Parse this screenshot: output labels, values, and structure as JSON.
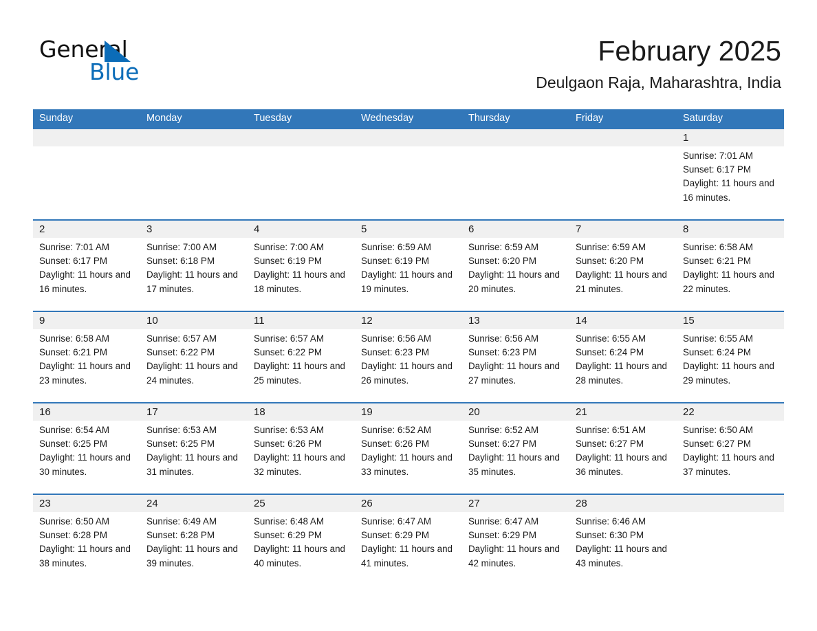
{
  "brand": {
    "name_part1": "General",
    "name_part2": "Blue",
    "accent_color": "#0b6cb8"
  },
  "header": {
    "title": "February 2025",
    "subtitle": "Deulgaon Raja, Maharashtra, India",
    "header_bar_color": "#3277b9",
    "daynum_band_color": "#f0f0f0"
  },
  "weekdays": [
    "Sunday",
    "Monday",
    "Tuesday",
    "Wednesday",
    "Thursday",
    "Friday",
    "Saturday"
  ],
  "weeks": [
    [
      {
        "day": "",
        "sunrise": "",
        "sunset": "",
        "daylight": ""
      },
      {
        "day": "",
        "sunrise": "",
        "sunset": "",
        "daylight": ""
      },
      {
        "day": "",
        "sunrise": "",
        "sunset": "",
        "daylight": ""
      },
      {
        "day": "",
        "sunrise": "",
        "sunset": "",
        "daylight": ""
      },
      {
        "day": "",
        "sunrise": "",
        "sunset": "",
        "daylight": ""
      },
      {
        "day": "",
        "sunrise": "",
        "sunset": "",
        "daylight": ""
      },
      {
        "day": "1",
        "sunrise": "Sunrise: 7:01 AM",
        "sunset": "Sunset: 6:17 PM",
        "daylight": "Daylight: 11 hours and 16 minutes."
      }
    ],
    [
      {
        "day": "2",
        "sunrise": "Sunrise: 7:01 AM",
        "sunset": "Sunset: 6:17 PM",
        "daylight": "Daylight: 11 hours and 16 minutes."
      },
      {
        "day": "3",
        "sunrise": "Sunrise: 7:00 AM",
        "sunset": "Sunset: 6:18 PM",
        "daylight": "Daylight: 11 hours and 17 minutes."
      },
      {
        "day": "4",
        "sunrise": "Sunrise: 7:00 AM",
        "sunset": "Sunset: 6:19 PM",
        "daylight": "Daylight: 11 hours and 18 minutes."
      },
      {
        "day": "5",
        "sunrise": "Sunrise: 6:59 AM",
        "sunset": "Sunset: 6:19 PM",
        "daylight": "Daylight: 11 hours and 19 minutes."
      },
      {
        "day": "6",
        "sunrise": "Sunrise: 6:59 AM",
        "sunset": "Sunset: 6:20 PM",
        "daylight": "Daylight: 11 hours and 20 minutes."
      },
      {
        "day": "7",
        "sunrise": "Sunrise: 6:59 AM",
        "sunset": "Sunset: 6:20 PM",
        "daylight": "Daylight: 11 hours and 21 minutes."
      },
      {
        "day": "8",
        "sunrise": "Sunrise: 6:58 AM",
        "sunset": "Sunset: 6:21 PM",
        "daylight": "Daylight: 11 hours and 22 minutes."
      }
    ],
    [
      {
        "day": "9",
        "sunrise": "Sunrise: 6:58 AM",
        "sunset": "Sunset: 6:21 PM",
        "daylight": "Daylight: 11 hours and 23 minutes."
      },
      {
        "day": "10",
        "sunrise": "Sunrise: 6:57 AM",
        "sunset": "Sunset: 6:22 PM",
        "daylight": "Daylight: 11 hours and 24 minutes."
      },
      {
        "day": "11",
        "sunrise": "Sunrise: 6:57 AM",
        "sunset": "Sunset: 6:22 PM",
        "daylight": "Daylight: 11 hours and 25 minutes."
      },
      {
        "day": "12",
        "sunrise": "Sunrise: 6:56 AM",
        "sunset": "Sunset: 6:23 PM",
        "daylight": "Daylight: 11 hours and 26 minutes."
      },
      {
        "day": "13",
        "sunrise": "Sunrise: 6:56 AM",
        "sunset": "Sunset: 6:23 PM",
        "daylight": "Daylight: 11 hours and 27 minutes."
      },
      {
        "day": "14",
        "sunrise": "Sunrise: 6:55 AM",
        "sunset": "Sunset: 6:24 PM",
        "daylight": "Daylight: 11 hours and 28 minutes."
      },
      {
        "day": "15",
        "sunrise": "Sunrise: 6:55 AM",
        "sunset": "Sunset: 6:24 PM",
        "daylight": "Daylight: 11 hours and 29 minutes."
      }
    ],
    [
      {
        "day": "16",
        "sunrise": "Sunrise: 6:54 AM",
        "sunset": "Sunset: 6:25 PM",
        "daylight": "Daylight: 11 hours and 30 minutes."
      },
      {
        "day": "17",
        "sunrise": "Sunrise: 6:53 AM",
        "sunset": "Sunset: 6:25 PM",
        "daylight": "Daylight: 11 hours and 31 minutes."
      },
      {
        "day": "18",
        "sunrise": "Sunrise: 6:53 AM",
        "sunset": "Sunset: 6:26 PM",
        "daylight": "Daylight: 11 hours and 32 minutes."
      },
      {
        "day": "19",
        "sunrise": "Sunrise: 6:52 AM",
        "sunset": "Sunset: 6:26 PM",
        "daylight": "Daylight: 11 hours and 33 minutes."
      },
      {
        "day": "20",
        "sunrise": "Sunrise: 6:52 AM",
        "sunset": "Sunset: 6:27 PM",
        "daylight": "Daylight: 11 hours and 35 minutes."
      },
      {
        "day": "21",
        "sunrise": "Sunrise: 6:51 AM",
        "sunset": "Sunset: 6:27 PM",
        "daylight": "Daylight: 11 hours and 36 minutes."
      },
      {
        "day": "22",
        "sunrise": "Sunrise: 6:50 AM",
        "sunset": "Sunset: 6:27 PM",
        "daylight": "Daylight: 11 hours and 37 minutes."
      }
    ],
    [
      {
        "day": "23",
        "sunrise": "Sunrise: 6:50 AM",
        "sunset": "Sunset: 6:28 PM",
        "daylight": "Daylight: 11 hours and 38 minutes."
      },
      {
        "day": "24",
        "sunrise": "Sunrise: 6:49 AM",
        "sunset": "Sunset: 6:28 PM",
        "daylight": "Daylight: 11 hours and 39 minutes."
      },
      {
        "day": "25",
        "sunrise": "Sunrise: 6:48 AM",
        "sunset": "Sunset: 6:29 PM",
        "daylight": "Daylight: 11 hours and 40 minutes."
      },
      {
        "day": "26",
        "sunrise": "Sunrise: 6:47 AM",
        "sunset": "Sunset: 6:29 PM",
        "daylight": "Daylight: 11 hours and 41 minutes."
      },
      {
        "day": "27",
        "sunrise": "Sunrise: 6:47 AM",
        "sunset": "Sunset: 6:29 PM",
        "daylight": "Daylight: 11 hours and 42 minutes."
      },
      {
        "day": "28",
        "sunrise": "Sunrise: 6:46 AM",
        "sunset": "Sunset: 6:30 PM",
        "daylight": "Daylight: 11 hours and 43 minutes."
      },
      {
        "day": "",
        "sunrise": "",
        "sunset": "",
        "daylight": ""
      }
    ]
  ]
}
